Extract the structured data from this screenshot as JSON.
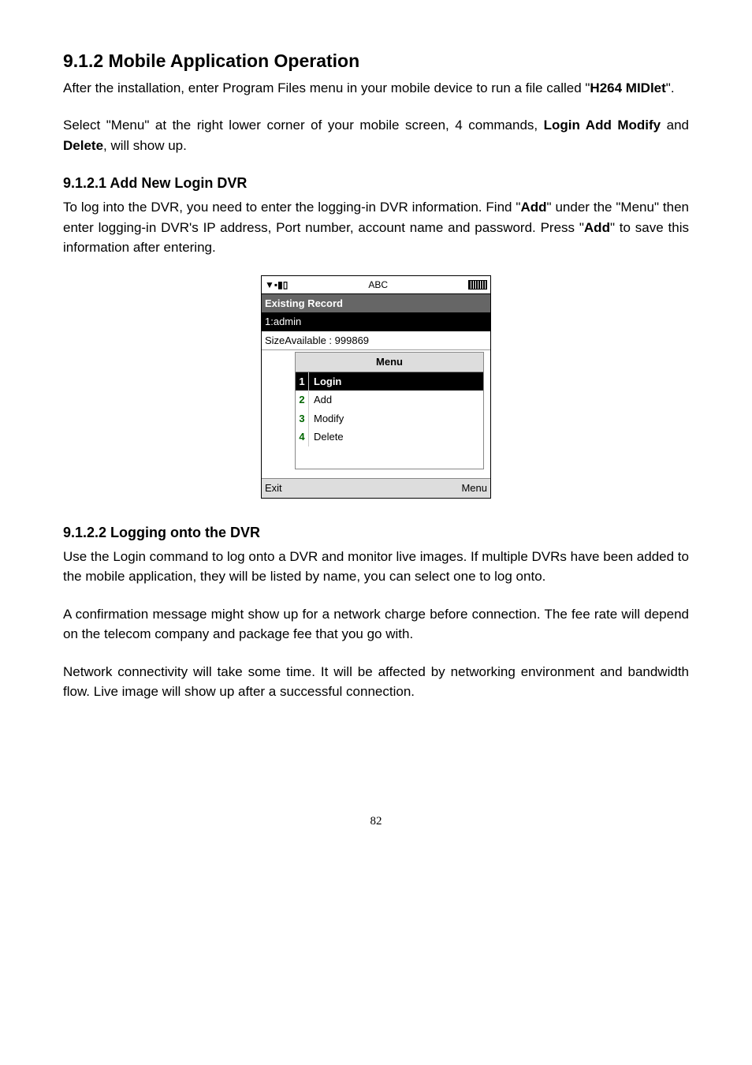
{
  "heading": "9.1.2 Mobile Application Operation",
  "intro1_a": "After the installation, enter Program Files menu in your mobile device to run a file called \"",
  "intro1_bold": "H264 MIDlet",
  "intro1_b": "\".",
  "intro2_a": "Select \"Menu\" at the right lower corner of your mobile screen, 4 commands, ",
  "intro2_bold1": "Login Add Modify",
  "intro2_mid": " and ",
  "intro2_bold2": "Delete",
  "intro2_b": ", will show up.",
  "sub1": "9.1.2.1 Add New Login DVR",
  "sub1p_a": "To log into the DVR, you need to enter the logging-in DVR information. Find \"",
  "sub1p_bold1": "Add",
  "sub1p_b": "\" under the \"Menu\" then enter logging-in DVR's IP address, Port number, account name and password. Press \"",
  "sub1p_bold2": "Add",
  "sub1p_c": "\" to save this information after entering.",
  "screenshot": {
    "signal": "▼▪▮▯",
    "abc": "ABC",
    "title": "Existing Record",
    "selected": "1:admin",
    "size": "SizeAvailable : 999869",
    "menu_header": "Menu",
    "items": [
      {
        "n": "1",
        "label": "Login"
      },
      {
        "n": "2",
        "label": "Add"
      },
      {
        "n": "3",
        "label": "Modify"
      },
      {
        "n": "4",
        "label": "Delete"
      }
    ],
    "soft_left": "Exit",
    "soft_right": "Menu"
  },
  "sub2": "9.1.2.2 Logging onto the DVR",
  "sub2p1": "Use the Login command to log onto a DVR and monitor live images. If multiple DVRs have been added to the mobile application, they will be listed by name, you can select one to log onto.",
  "sub2p2": "A confirmation message might show up for a network charge before connection. The fee rate will depend on the telecom company and package fee that you go with.",
  "sub2p3": "Network connectivity will take some time. It will be affected by networking environment and bandwidth flow. Live image will show up after a successful connection.",
  "page": "82"
}
